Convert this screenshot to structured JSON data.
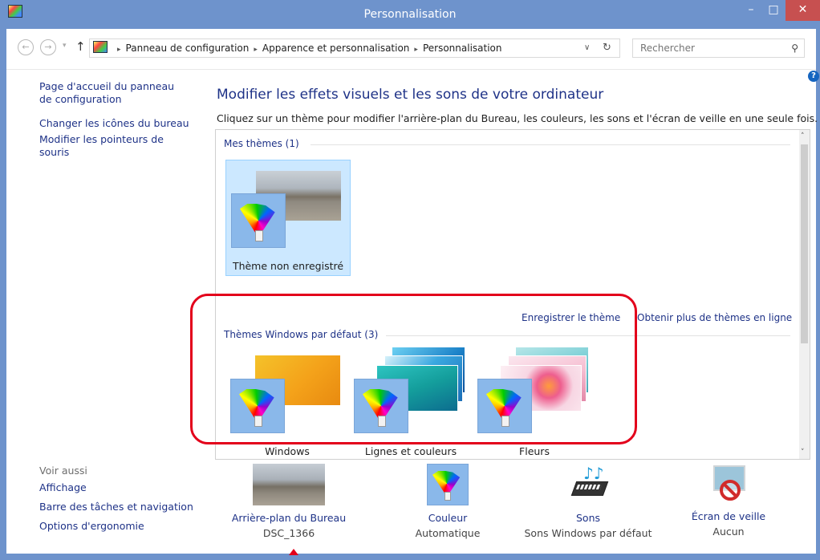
{
  "window": {
    "title": "Personnalisation",
    "minimize": "–",
    "maximize": "□",
    "close": "✕"
  },
  "nav": {
    "back": "←",
    "forward": "→",
    "dropdown": "▾",
    "up": "↑"
  },
  "breadcrumb": {
    "items": [
      "Panneau de configuration",
      "Apparence et personnalisation",
      "Personnalisation"
    ],
    "separator": "▸",
    "dropdown": "∨",
    "refresh": "↻"
  },
  "search": {
    "placeholder": "Rechercher",
    "icon": "search-icon"
  },
  "help": {
    "glyph": "?"
  },
  "sidebar": {
    "links": [
      "Page d'accueil du panneau de configuration",
      "Changer les icônes du bureau",
      "Modifier les pointeurs de souris"
    ],
    "see_also": {
      "title": "Voir aussi",
      "links": [
        "Affichage",
        "Barre des tâches et navigation",
        "Options d'ergonomie"
      ]
    }
  },
  "main": {
    "heading": "Modifier les effets visuels et les sons de votre ordinateur",
    "description": "Cliquez sur un thème pour modifier l'arrière-plan du Bureau, les couleurs, les sons et l'écran de veille en une seule fois.",
    "my_themes": {
      "label": "Mes thèmes (1)",
      "themes": [
        {
          "name": "Thème non enregistré"
        }
      ]
    },
    "save_theme": "Enregistrer le thème",
    "get_more": "Obtenir plus de thèmes en ligne",
    "default_themes": {
      "label": "Thèmes Windows par défaut (3)",
      "themes": [
        {
          "name": "Windows"
        },
        {
          "name": "Lignes et couleurs"
        },
        {
          "name": "Fleurs"
        }
      ]
    },
    "scroll": {
      "up": "˄",
      "down": "˅"
    }
  },
  "bottom_bar": [
    {
      "label": "Arrière-plan du Bureau",
      "value": "DSC_1366"
    },
    {
      "label": "Couleur",
      "value": "Automatique"
    },
    {
      "label": "Sons",
      "value": "Sons Windows par défaut"
    },
    {
      "label": "Écran de veille",
      "value": "Aucun"
    }
  ],
  "colors": {
    "titlebar": "#6e93cc",
    "link": "#1e3287",
    "selection": "#cce8ff",
    "highlight": "#e3001b",
    "close": "#c75050"
  }
}
